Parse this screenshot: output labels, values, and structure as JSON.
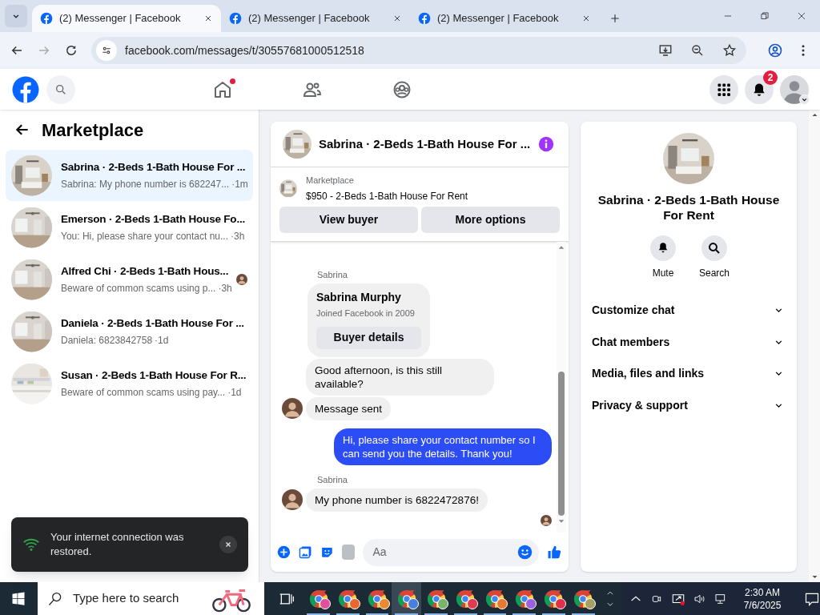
{
  "browser": {
    "tabs": [
      {
        "title": "(2) Messenger | Facebook",
        "selected": true
      },
      {
        "title": "(2) Messenger | Facebook",
        "selected": false
      },
      {
        "title": "(2) Messenger | Facebook",
        "selected": false
      }
    ],
    "url": "facebook.com/messages/t/30557681000512518"
  },
  "top_nav": {
    "home_has_new": true,
    "notification_count": "2"
  },
  "sidebar": {
    "title": "Marketplace",
    "conversations": [
      {
        "name": "Sabrina · 2-Beds 1-Bath House For ...",
        "preview": "Sabrina: My phone number is 682247...",
        "time": "·1m",
        "selected": true,
        "seen_avatar": false
      },
      {
        "name": "Emerson · 2-Beds 1-Bath House Fo...",
        "preview": "You: Hi, please share your contact nu...",
        "time": "·3h",
        "selected": false,
        "seen_avatar": false
      },
      {
        "name": "Alfred Chi · 2-Beds 1-Bath Hous...",
        "preview": "Beware of common scams using p...",
        "time": "·3h",
        "selected": false,
        "seen_avatar": true
      },
      {
        "name": "Daniela · 2-Beds 1-Bath House For ...",
        "preview": "Daniela: 6823842758",
        "time": "·1d",
        "selected": false,
        "seen_avatar": false
      },
      {
        "name": "Susan · 2-Beds 1-Bath House For R...",
        "preview": "Beware of common scams using pay...",
        "time": "·1d",
        "selected": false,
        "seen_avatar": false
      }
    ]
  },
  "chat": {
    "title": "Sabrina · 2-Beds 1-Bath House For ...",
    "listing": {
      "source": "Marketplace",
      "title": "$950 - 2-Beds 1-Bath House For Rent"
    },
    "buttons": [
      "View buyer",
      "More options"
    ],
    "messages": [
      {
        "kind": "sender",
        "text": "Sabrina"
      },
      {
        "kind": "profile_card",
        "name": "Sabrina Murphy",
        "subtitle": "Joined Facebook in 2009",
        "button": "Buyer details"
      },
      {
        "kind": "incoming",
        "text": "Good afternoon, is this still available?",
        "avatar": false
      },
      {
        "kind": "incoming",
        "text": "Message sent",
        "avatar": true
      },
      {
        "kind": "outgoing",
        "text": "Hi, please share your contact number so I can send you the details. Thank you!"
      },
      {
        "kind": "sender",
        "text": "Sabrina"
      },
      {
        "kind": "incoming",
        "text": "My phone number is 6822472876!",
        "avatar": true
      },
      {
        "kind": "seen"
      }
    ],
    "composer": {
      "placeholder": "Aa"
    }
  },
  "details": {
    "name": "Sabrina · 2-Beds 1-Bath House For Rent",
    "actions": [
      {
        "kind": "mute",
        "label": "Mute"
      },
      {
        "kind": "search",
        "label": "Search"
      }
    ],
    "sections": [
      "Customize chat",
      "Chat members",
      "Media, files and links",
      "Privacy & support"
    ]
  },
  "toast": {
    "text": "Your internet connection was restored."
  },
  "taskbar": {
    "search_placeholder": "Type here to search",
    "apps": [
      {
        "color": "#e0509c",
        "selected": false
      },
      {
        "color": "#e8672f",
        "selected": false
      },
      {
        "color": "#e88a2f",
        "selected": false
      },
      {
        "color": "#4a7fe0",
        "selected": true
      },
      {
        "color": "#7cb36a",
        "selected": false
      },
      {
        "color": "#e23a4e",
        "selected": false
      },
      {
        "color": "#e87a2f",
        "selected": false
      },
      {
        "color": "#9b5fe0",
        "selected": false
      },
      {
        "color": "#e2304a",
        "selected": false
      },
      {
        "color": "#a8a060",
        "selected": false
      }
    ],
    "time": "2:30 AM",
    "date": "7/6/2025"
  }
}
